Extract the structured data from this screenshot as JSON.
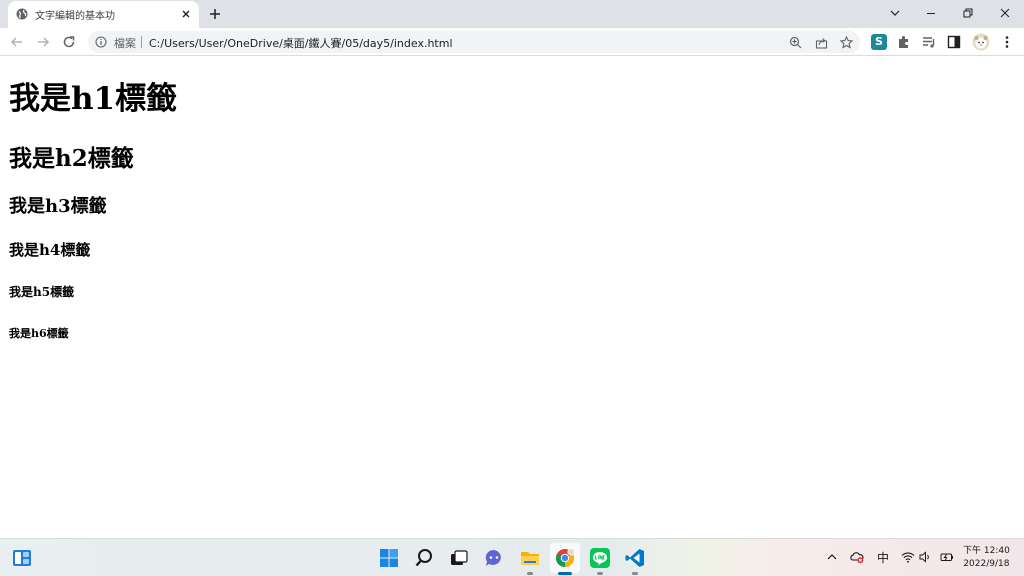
{
  "browser": {
    "tab_title": "文字編輯的基本功",
    "scheme_label": "檔案",
    "url": "C:/Users/User/OneDrive/桌面/鐵人賽/05/day5/index.html",
    "extension_badge": "S"
  },
  "page": {
    "headings": [
      "我是h1標籤",
      "我是h2標籤",
      "我是h3標籤",
      "我是h4標籤",
      "我是h5標籤",
      "我是h6標籤"
    ]
  },
  "taskbar": {
    "ime_indicator": "中",
    "clock_time": "下午 12:40",
    "clock_date": "2022/9/18"
  },
  "colors": {
    "accent": "#0067c0",
    "line_green": "#06c755",
    "vscode_blue": "#007acc"
  }
}
